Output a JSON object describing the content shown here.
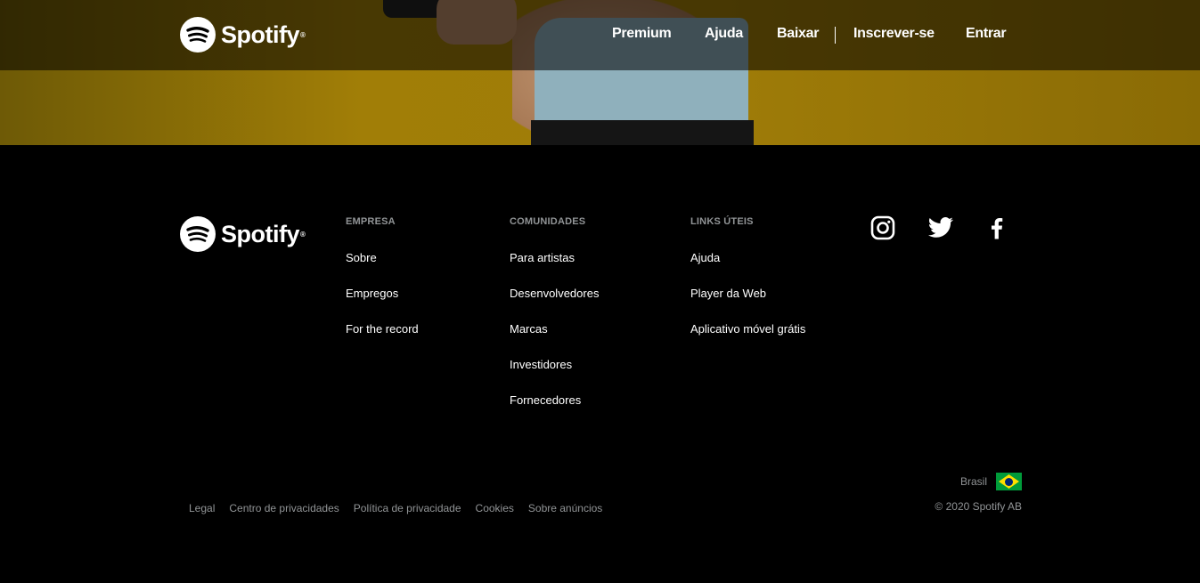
{
  "brand": {
    "name": "Spotify"
  },
  "topnav": {
    "items": [
      "Premium",
      "Ajuda",
      "Baixar",
      "Inscrever-se",
      "Entrar"
    ]
  },
  "footer": {
    "columns": [
      {
        "heading": "EMPRESA",
        "links": [
          "Sobre",
          "Empregos",
          "For the record"
        ]
      },
      {
        "heading": "COMUNIDADES",
        "links": [
          "Para artistas",
          "Desenvolvedores",
          "Marcas",
          "Investidores",
          "Fornecedores"
        ]
      },
      {
        "heading": "LINKS ÚTEIS",
        "links": [
          "Ajuda",
          "Player da Web",
          "Aplicativo móvel grátis"
        ]
      }
    ],
    "social": [
      "instagram-icon",
      "twitter-icon",
      "facebook-icon"
    ],
    "legal_links": [
      "Legal",
      "Centro de privacidades",
      "Política de privacidade",
      "Cookies",
      "Sobre anúncios"
    ],
    "country": "Brasil",
    "copyright": "© 2020 Spotify AB"
  },
  "colors": {
    "hero_accent": "#a17e07",
    "footer_bg": "#000000",
    "muted_text": "#919496"
  }
}
